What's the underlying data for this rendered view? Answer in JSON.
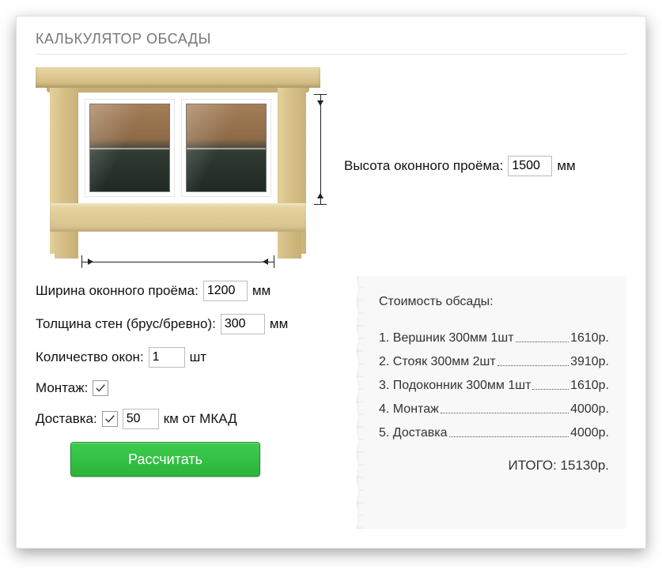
{
  "title": "КАЛЬКУЛЯТОР ОБСАДЫ",
  "height": {
    "label": "Высота оконного проёма:",
    "value": "1500",
    "unit": "мм"
  },
  "form": {
    "width": {
      "label": "Ширина оконного проёма:",
      "value": "1200",
      "unit": "мм"
    },
    "thick": {
      "label": "Толщина стен (брус/бревно):",
      "value": "300",
      "unit": "мм"
    },
    "qty": {
      "label": "Количество окон:",
      "value": "1",
      "unit": "шт"
    },
    "install": {
      "label": "Монтаж:",
      "checked": true
    },
    "delivery": {
      "label": "Доставка:",
      "checked": true,
      "value": "50",
      "unit": "км от МКАД"
    },
    "button": "Рассчитать"
  },
  "cost": {
    "title": "Стоимость обсады:",
    "items": [
      {
        "n": "1.",
        "name": "Вершник 300мм 1шт",
        "price": "1610р."
      },
      {
        "n": "2.",
        "name": "Стояк 300мм 2шт",
        "price": "3910р."
      },
      {
        "n": "3.",
        "name": "Подоконник 300мм 1шт",
        "price": "1610р."
      },
      {
        "n": "4.",
        "name": "Монтаж",
        "price": "4000р."
      },
      {
        "n": "5.",
        "name": "Доставка",
        "price": "4000р."
      }
    ],
    "total_label": "ИТОГО:",
    "total_value": "15130р."
  }
}
